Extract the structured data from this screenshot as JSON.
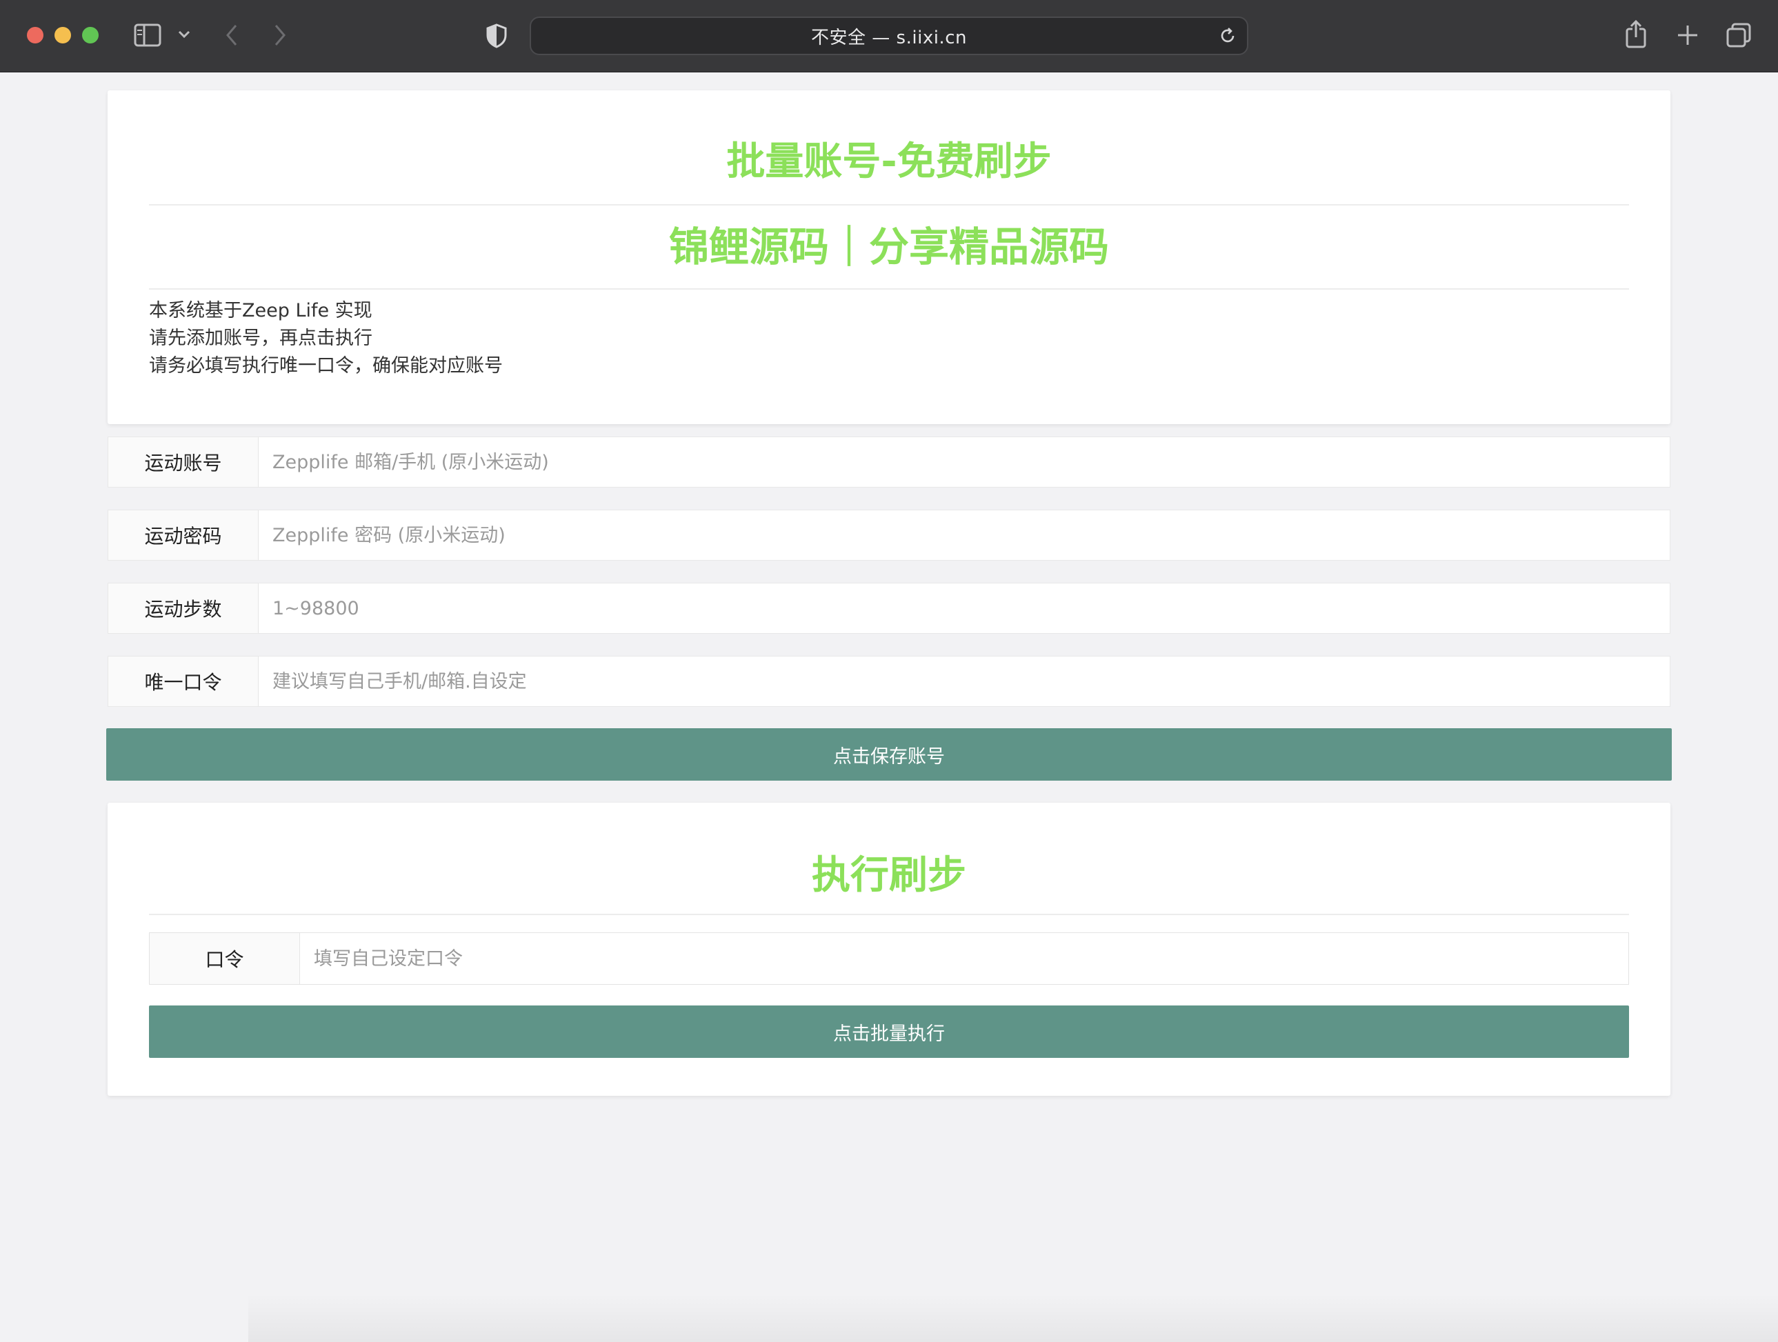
{
  "browser": {
    "address": "不安全 — s.iixi.cn",
    "icons": {
      "sidebar": "sidebar-icon",
      "chevron": "chevron-down-icon",
      "back": "back-arrow-icon",
      "forward": "forward-arrow-icon",
      "privacy": "shield-icon",
      "reload": "reload-icon",
      "share": "share-icon",
      "new_tab": "plus-icon",
      "tabs": "tabs-overview-icon"
    }
  },
  "intro": {
    "title": "批量账号-免费刷步",
    "subtitle": "锦鲤源码｜分享精品源码",
    "notes": [
      "本系统基于Zeep Life 实现",
      "请先添加账号，再点击执行",
      "请务必填写执行唯一口令，确保能对应账号"
    ]
  },
  "form": {
    "account": {
      "label": "运动账号",
      "placeholder": "Zepplife 邮箱/手机 (原小米运动)"
    },
    "password": {
      "label": "运动密码",
      "placeholder": "Zepplife 密码 (原小米运动)"
    },
    "steps": {
      "label": "运动步数",
      "placeholder": "1~98800"
    },
    "token": {
      "label": "唯一口令",
      "placeholder": "建议填写自己手机/邮箱.自设定"
    },
    "save_button": "点击保存账号"
  },
  "execute": {
    "title": "执行刷步",
    "token_label": "口令",
    "token_placeholder": "填写自己设定口令",
    "run_button": "点击批量执行"
  },
  "colors": {
    "accent_green": "#8ce05a",
    "button_teal": "#5f9488",
    "chrome_bg": "#38383a"
  }
}
